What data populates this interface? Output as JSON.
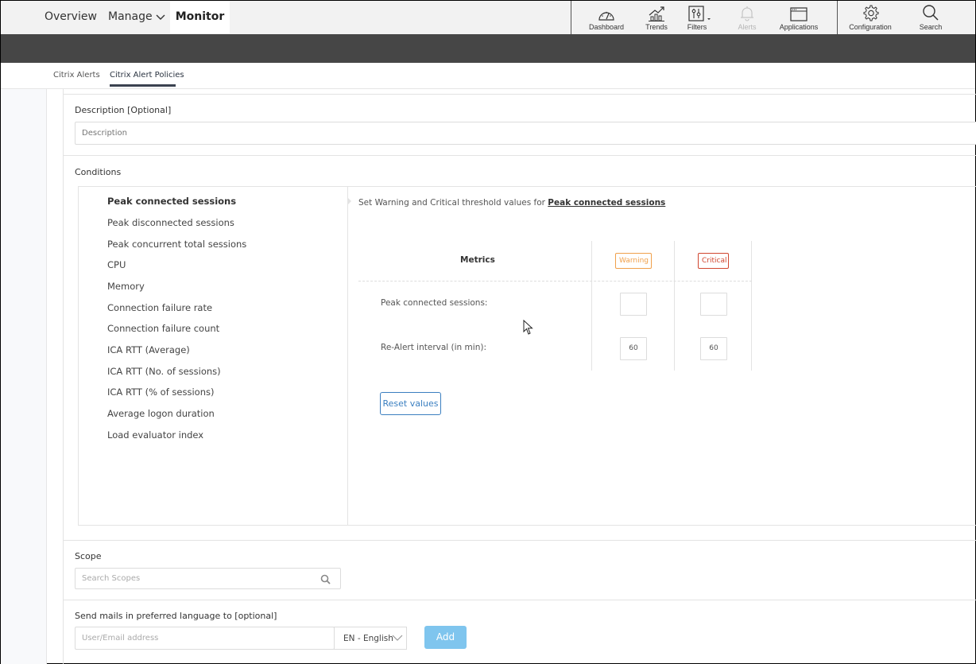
{
  "topnav": {
    "overview": "Overview",
    "manage": "Manage",
    "monitor": "Monitor"
  },
  "toolbar": {
    "items": [
      {
        "label": "Dashboard",
        "icon": "dashboard-gauge-icon",
        "enabled": true
      },
      {
        "label": "Trends",
        "icon": "trends-chart-icon",
        "enabled": true
      },
      {
        "label": "Filters",
        "icon": "filters-sliders-icon",
        "enabled": true
      },
      {
        "label": "Alerts",
        "icon": "bell-icon",
        "enabled": false
      },
      {
        "label": "Applications",
        "icon": "application-window-icon",
        "enabled": true
      },
      {
        "label": "Configuration",
        "icon": "gear-icon",
        "enabled": true
      },
      {
        "label": "Search",
        "icon": "search-icon",
        "enabled": true
      }
    ]
  },
  "subnav": {
    "tabs": [
      {
        "label": "Citrix Alerts",
        "active": false
      },
      {
        "label": "Citrix Alert Policies",
        "active": true
      }
    ]
  },
  "description": {
    "label": "Description [Optional]",
    "placeholder": "Description",
    "value": ""
  },
  "conditions": {
    "label": "Conditions",
    "metrics": [
      {
        "label": "Peak connected sessions",
        "active": true
      },
      {
        "label": "Peak disconnected sessions",
        "active": false
      },
      {
        "label": "Peak concurrent total sessions",
        "active": false
      },
      {
        "label": "CPU",
        "active": false
      },
      {
        "label": "Memory",
        "active": false
      },
      {
        "label": "Connection failure rate",
        "active": false
      },
      {
        "label": "Connection failure count",
        "active": false
      },
      {
        "label": "ICA RTT (Average)",
        "active": false
      },
      {
        "label": "ICA RTT (No. of sessions)",
        "active": false
      },
      {
        "label": "ICA RTT (% of sessions)",
        "active": false
      },
      {
        "label": "Average logon duration",
        "active": false
      },
      {
        "label": "Load evaluator index",
        "active": false
      }
    ],
    "threshold_prefix": "Set Warning and Critical threshold values for",
    "threshold_metric": "Peak connected sessions",
    "table": {
      "metrics_header": "Metrics",
      "warning_header": "Warning",
      "critical_header": "Critical",
      "rows": [
        {
          "label": "Peak connected sessions:",
          "warning": "",
          "critical": ""
        },
        {
          "label": "Re-Alert interval (in min):",
          "warning": "60",
          "critical": "60"
        }
      ]
    },
    "reset_label": "Reset values"
  },
  "scope": {
    "label": "Scope",
    "placeholder": "Search Scopes"
  },
  "mail": {
    "label": "Send mails in preferred language to [optional]",
    "placeholder": "User/Email address",
    "language": "EN - English",
    "add_label": "Add"
  },
  "colors": {
    "warning": "#f0a04b",
    "critical": "#d0462f",
    "accent": "#3b7fc0",
    "add_button": "#7fc5ee",
    "header_dark": "#464646"
  }
}
